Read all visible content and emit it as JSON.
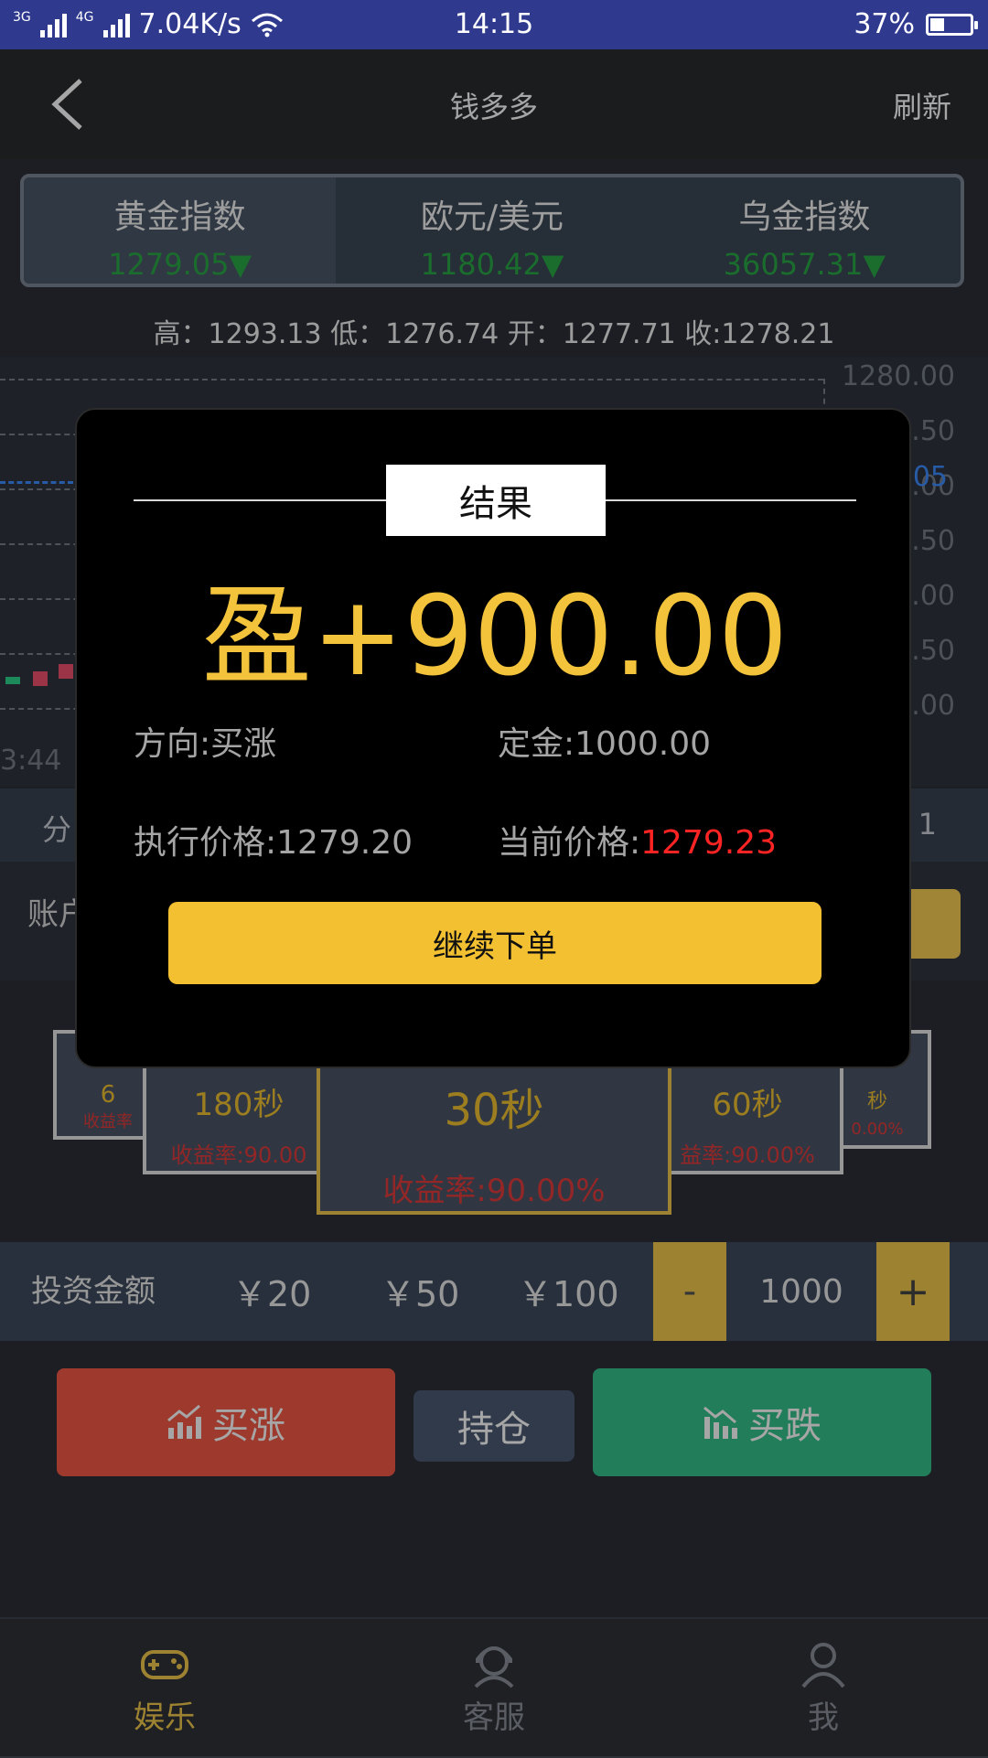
{
  "status_bar": {
    "network1": "3G",
    "network2": "4G",
    "speed": "7.04K/s",
    "time": "14:15",
    "battery": "37%",
    "battery_level": 0.37
  },
  "header": {
    "title": "钱多多",
    "refresh": "刷新"
  },
  "market_tabs": [
    {
      "name": "黄金指数",
      "value": "1279.05▼"
    },
    {
      "name": "欧元/美元",
      "value": "1180.42▼"
    },
    {
      "name": "乌金指数",
      "value": "36057.31▼"
    }
  ],
  "ohlc": "高：1293.13 低：1276.74 开：1277.71 收:1278.21",
  "chart": {
    "y_labels": [
      "1280.00",
      ".50",
      ".00",
      ".50",
      ".00",
      ".50",
      ".00"
    ],
    "current_label": "05",
    "time_label": "3:44"
  },
  "period_bar": {
    "left_text": "分",
    "right_text": "1"
  },
  "account": {
    "label": "账户"
  },
  "time_cards": [
    {
      "sec": "6",
      "rate": "收益率"
    },
    {
      "sec": "180秒",
      "rate": "收益率:90.00"
    },
    {
      "sec": "30秒",
      "rate": "收益率:90.00%"
    },
    {
      "sec": "60秒",
      "rate": "益率:90.00%"
    },
    {
      "sec": "秒",
      "rate": "0.00%"
    }
  ],
  "invest": {
    "label": "投资金额",
    "amounts": [
      "￥20",
      "￥50",
      "￥100"
    ],
    "minus": "-",
    "value": "1000",
    "plus": "+"
  },
  "actions": {
    "buy_up": "买涨",
    "hold": "持仓",
    "buy_down": "买跌"
  },
  "nav": [
    {
      "label": "娱乐",
      "icon": "gamepad-icon"
    },
    {
      "label": "客服",
      "icon": "support-icon"
    },
    {
      "label": "我",
      "icon": "user-icon"
    }
  ],
  "modal": {
    "title": "结果",
    "profit": "盈+900.00",
    "direction": "方向:买涨",
    "deposit": "定金:1000.00",
    "exec_price": "执行价格:1279.20",
    "current_price_label": "当前价格:",
    "current_price_value": "1279.23",
    "continue": "继续下单"
  }
}
